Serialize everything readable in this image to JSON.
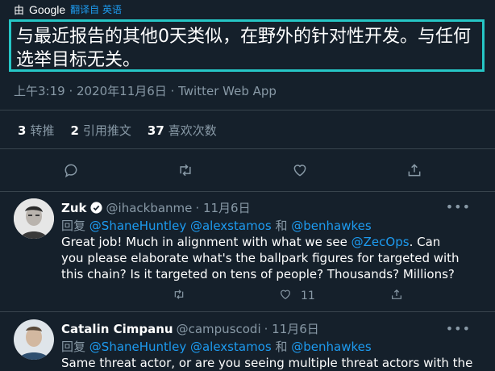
{
  "translate_bar": {
    "by": "由",
    "google": "Google",
    "link": "翻译自 英语"
  },
  "translation": "与最近报告的其他0天类似，在野外的针对性开发。与任何选举目标无关。",
  "meta": "上午3:19 · 2020年11月6日 · Twitter Web App",
  "stats": [
    {
      "count": "3",
      "label": "转推"
    },
    {
      "count": "2",
      "label": "引用推文"
    },
    {
      "count": "37",
      "label": "喜欢次数"
    }
  ],
  "replies": [
    {
      "name": "Zuk",
      "handle": "@ihackbanme",
      "date": "· 11月6日",
      "reply_prefix": "回复",
      "mention1": "@ShaneHuntley",
      "mention2": "@alexstamos",
      "and": "和",
      "mention3": "@benhawkes",
      "body_a": "Great job! Much in alignment with what we see ",
      "body_mention": "@ZecOps",
      "body_b": ". Can you please elaborate what's the ballpark figures for targeted with this chain? Is it targeted on tens of people? Thousands? Millions?",
      "like_count": "11",
      "more": "•••"
    },
    {
      "name": "Catalin Cimpanu",
      "handle": "@campuscodi",
      "date": "· 11月6日",
      "reply_prefix": "回复",
      "mention1": "@ShaneHuntley",
      "mention2": "@alexstamos",
      "and": "和",
      "mention3": "@benhawkes",
      "body": "Same threat actor, or are you seeing multiple threat actors with the",
      "more": "•••"
    }
  ],
  "colors": {
    "background": "#15202b",
    "accent": "#1d9bf0",
    "muted": "#8899a6",
    "highlight_border": "#26c6c6"
  }
}
